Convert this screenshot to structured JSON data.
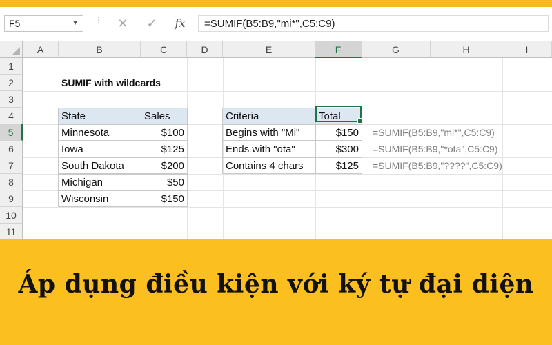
{
  "formula_bar": {
    "name_box": "F5",
    "cancel_glyph": "✕",
    "enter_glyph": "✓",
    "fx_label": "fx",
    "formula": "=SUMIF(B5:B9,\"mi*\",C5:C9)"
  },
  "columns": [
    "A",
    "B",
    "C",
    "D",
    "E",
    "F",
    "G",
    "H",
    "I"
  ],
  "selected_column": "F",
  "rows": [
    "1",
    "2",
    "3",
    "4",
    "5",
    "6",
    "7",
    "8",
    "9",
    "10",
    "11"
  ],
  "selected_row": "5",
  "sheet": {
    "title": "SUMIF with wildcards",
    "table1": {
      "headers": [
        "State",
        "Sales"
      ],
      "rows": [
        [
          "Minnesota",
          "$100"
        ],
        [
          "Iowa",
          "$125"
        ],
        [
          "South Dakota",
          "$200"
        ],
        [
          "Michigan",
          "$50"
        ],
        [
          "Wisconsin",
          "$150"
        ]
      ]
    },
    "table2": {
      "headers": [
        "Criteria",
        "Total"
      ],
      "rows": [
        [
          "Begins with \"Mi\"",
          "$150"
        ],
        [
          "Ends with \"ota\"",
          "$300"
        ],
        [
          "Contains 4 chars",
          "$125"
        ]
      ]
    },
    "formulas": [
      "=SUMIF(B5:B9,\"mi*\",C5:C9)",
      "=SUMIF(B5:B9,\"*ota\",C5:C9)",
      "=SUMIF(B5:B9,\"????\",C5:C9)"
    ]
  },
  "caption": "Áp dụng điều kiện với ký tự đại diện",
  "colors": {
    "banner": "#fbbf1f",
    "header_fill": "#dde7f2",
    "selection": "#217346"
  }
}
